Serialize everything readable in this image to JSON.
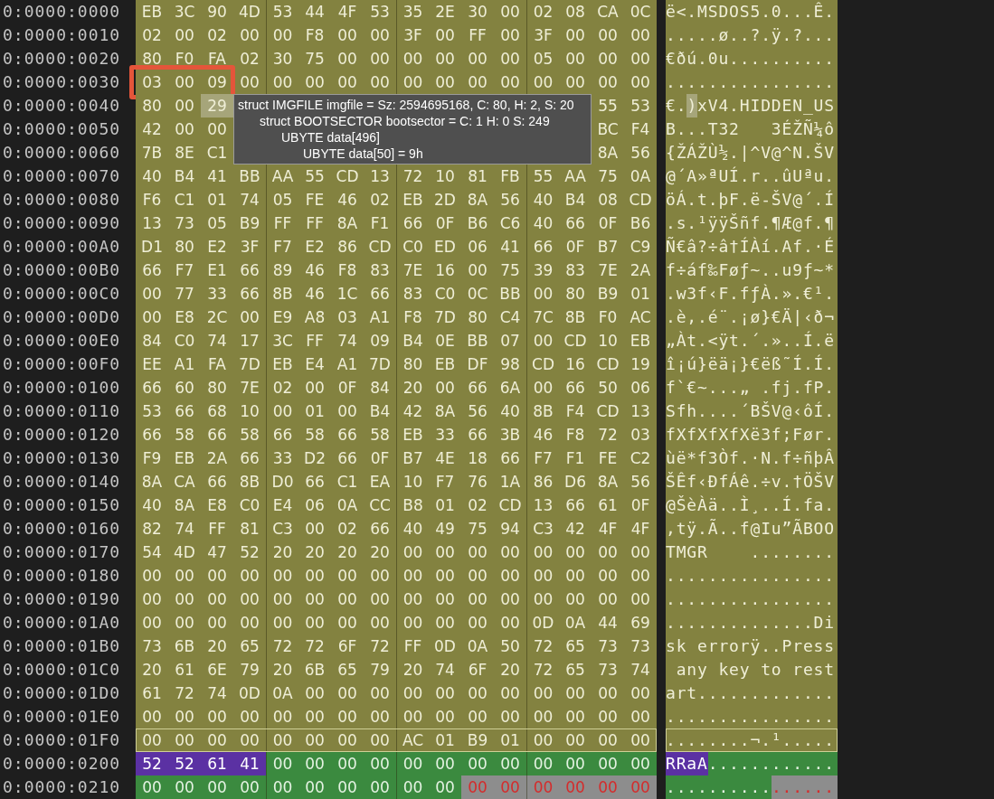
{
  "rows": [
    {
      "offset": "0:0000:0000",
      "framed": false,
      "outlined": false,
      "hex": [
        {
          "kind": "boot",
          "bytes": [
            "EB",
            "3C",
            "90",
            "4D",
            "53",
            "44",
            "4F",
            "53",
            "35",
            "2E",
            "30",
            "00",
            "02",
            "08",
            "CA",
            "0C"
          ]
        }
      ],
      "ascii": [
        {
          "kind": "boot",
          "text": "ë<.MSDOS5.0...Ê."
        }
      ]
    },
    {
      "offset": "0:0000:0010",
      "framed": false,
      "outlined": false,
      "hex": [
        {
          "kind": "boot",
          "bytes": [
            "02",
            "00",
            "02",
            "00",
            "00",
            "F8",
            "00",
            "00",
            "3F",
            "00",
            "FF",
            "00",
            "3F",
            "00",
            "00",
            "00"
          ]
        }
      ],
      "ascii": [
        {
          "kind": "boot",
          "text": ".....ø..?.ÿ.?..."
        }
      ]
    },
    {
      "offset": "0:0000:0020",
      "framed": false,
      "outlined": false,
      "hex": [
        {
          "kind": "boot",
          "bytes": [
            "80",
            "F0",
            "FA",
            "02",
            "30",
            "75",
            "00",
            "00",
            "00",
            "00",
            "00",
            "00",
            "05",
            "00",
            "00",
            "00"
          ]
        }
      ],
      "ascii": [
        {
          "kind": "boot",
          "text": "€ðú.0u.........."
        }
      ]
    },
    {
      "offset": "0:0000:0030",
      "framed": true,
      "outlined": false,
      "hex": [
        {
          "kind": "boot",
          "bytes": [
            "03",
            "00",
            "09",
            "00",
            "00",
            "00",
            "00",
            "00",
            "00",
            "00",
            "00",
            "00",
            "00",
            "00",
            "00",
            "00"
          ]
        }
      ],
      "ascii": [
        {
          "kind": "boot",
          "text": "................"
        }
      ]
    },
    {
      "offset": "0:0000:0040",
      "framed": false,
      "outlined": false,
      "hex": [
        {
          "kind": "boot",
          "bytes": [
            "80",
            "00"
          ]
        },
        {
          "kind": "cursor",
          "bytes": [
            "29"
          ]
        },
        {
          "kind": "covered"
        },
        {
          "kind": "boot",
          "bytes": [
            "55",
            "53"
          ]
        }
      ],
      "ascii": [
        {
          "kind": "boot",
          "text": "€."
        },
        {
          "kind": "cursor",
          "text": ")"
        },
        {
          "kind": "boot",
          "text": "xV4.HIDDEN_US"
        }
      ]
    },
    {
      "offset": "0:0000:0050",
      "framed": false,
      "outlined": false,
      "hex": [
        {
          "kind": "boot",
          "bytes": [
            "42",
            "00",
            "00"
          ]
        },
        {
          "kind": "covered"
        },
        {
          "kind": "boot",
          "bytes": [
            "BC",
            "F4"
          ]
        }
      ],
      "ascii": [
        {
          "kind": "boot",
          "text": "B...T32   3ÉŽÑ¼ô"
        }
      ]
    },
    {
      "offset": "0:0000:0060",
      "framed": false,
      "outlined": false,
      "hex": [
        {
          "kind": "boot",
          "bytes": [
            "7B",
            "8E",
            "C1"
          ]
        },
        {
          "kind": "covered"
        },
        {
          "kind": "boot",
          "bytes": [
            "8A",
            "56"
          ]
        }
      ],
      "ascii": [
        {
          "kind": "boot",
          "text": "{ŽÁŽÙ½.|^V@^N.ŠV"
        }
      ]
    },
    {
      "offset": "0:0000:0070",
      "framed": false,
      "outlined": false,
      "hex": [
        {
          "kind": "boot",
          "bytes": [
            "40",
            "B4",
            "41",
            "BB",
            "AA",
            "55",
            "CD",
            "13",
            "72",
            "10",
            "81",
            "FB",
            "55",
            "AA",
            "75",
            "0A"
          ]
        }
      ],
      "ascii": [
        {
          "kind": "boot",
          "text": "@´A»ªUÍ.r..ûUªu."
        }
      ]
    },
    {
      "offset": "0:0000:0080",
      "framed": false,
      "outlined": false,
      "hex": [
        {
          "kind": "boot",
          "bytes": [
            "F6",
            "C1",
            "01",
            "74",
            "05",
            "FE",
            "46",
            "02",
            "EB",
            "2D",
            "8A",
            "56",
            "40",
            "B4",
            "08",
            "CD"
          ]
        }
      ],
      "ascii": [
        {
          "kind": "boot",
          "text": "öÁ.t.þF.ë-ŠV@´.Í"
        }
      ]
    },
    {
      "offset": "0:0000:0090",
      "framed": false,
      "outlined": false,
      "hex": [
        {
          "kind": "boot",
          "bytes": [
            "13",
            "73",
            "05",
            "B9",
            "FF",
            "FF",
            "8A",
            "F1",
            "66",
            "0F",
            "B6",
            "C6",
            "40",
            "66",
            "0F",
            "B6"
          ]
        }
      ],
      "ascii": [
        {
          "kind": "boot",
          "text": ".s.¹ÿÿŠñf.¶Æ@f.¶"
        }
      ]
    },
    {
      "offset": "0:0000:00A0",
      "framed": false,
      "outlined": false,
      "hex": [
        {
          "kind": "boot",
          "bytes": [
            "D1",
            "80",
            "E2",
            "3F",
            "F7",
            "E2",
            "86",
            "CD",
            "C0",
            "ED",
            "06",
            "41",
            "66",
            "0F",
            "B7",
            "C9"
          ]
        }
      ],
      "ascii": [
        {
          "kind": "boot",
          "text": "Ñ€â?÷â†ÍÀí.Af.·É"
        }
      ]
    },
    {
      "offset": "0:0000:00B0",
      "framed": false,
      "outlined": false,
      "hex": [
        {
          "kind": "boot",
          "bytes": [
            "66",
            "F7",
            "E1",
            "66",
            "89",
            "46",
            "F8",
            "83",
            "7E",
            "16",
            "00",
            "75",
            "39",
            "83",
            "7E",
            "2A"
          ]
        }
      ],
      "ascii": [
        {
          "kind": "boot",
          "text": "f÷áf‰Føƒ~..u9ƒ~*"
        }
      ]
    },
    {
      "offset": "0:0000:00C0",
      "framed": false,
      "outlined": false,
      "hex": [
        {
          "kind": "boot",
          "bytes": [
            "00",
            "77",
            "33",
            "66",
            "8B",
            "46",
            "1C",
            "66",
            "83",
            "C0",
            "0C",
            "BB",
            "00",
            "80",
            "B9",
            "01"
          ]
        }
      ],
      "ascii": [
        {
          "kind": "boot",
          "text": ".w3f‹F.fƒÀ.».€¹."
        }
      ]
    },
    {
      "offset": "0:0000:00D0",
      "framed": false,
      "outlined": false,
      "hex": [
        {
          "kind": "boot",
          "bytes": [
            "00",
            "E8",
            "2C",
            "00",
            "E9",
            "A8",
            "03",
            "A1",
            "F8",
            "7D",
            "80",
            "C4",
            "7C",
            "8B",
            "F0",
            "AC"
          ]
        }
      ],
      "ascii": [
        {
          "kind": "boot",
          "text": ".è,.é¨.¡ø}€Ä|‹ð¬"
        }
      ]
    },
    {
      "offset": "0:0000:00E0",
      "framed": false,
      "outlined": false,
      "hex": [
        {
          "kind": "boot",
          "bytes": [
            "84",
            "C0",
            "74",
            "17",
            "3C",
            "FF",
            "74",
            "09",
            "B4",
            "0E",
            "BB",
            "07",
            "00",
            "CD",
            "10",
            "EB"
          ]
        }
      ],
      "ascii": [
        {
          "kind": "boot",
          "text": "„Àt.<ÿt.´.»..Í.ë"
        }
      ]
    },
    {
      "offset": "0:0000:00F0",
      "framed": false,
      "outlined": false,
      "hex": [
        {
          "kind": "boot",
          "bytes": [
            "EE",
            "A1",
            "FA",
            "7D",
            "EB",
            "E4",
            "A1",
            "7D",
            "80",
            "EB",
            "DF",
            "98",
            "CD",
            "16",
            "CD",
            "19"
          ]
        }
      ],
      "ascii": [
        {
          "kind": "boot",
          "text": "î¡ú}ëä¡}€ëß˜Í.Í."
        }
      ]
    },
    {
      "offset": "0:0000:0100",
      "framed": false,
      "outlined": false,
      "hex": [
        {
          "kind": "boot",
          "bytes": [
            "66",
            "60",
            "80",
            "7E",
            "02",
            "00",
            "0F",
            "84",
            "20",
            "00",
            "66",
            "6A",
            "00",
            "66",
            "50",
            "06"
          ]
        }
      ],
      "ascii": [
        {
          "kind": "boot",
          "text": "f`€~...„ .fj.fP."
        }
      ]
    },
    {
      "offset": "0:0000:0110",
      "framed": false,
      "outlined": false,
      "hex": [
        {
          "kind": "boot",
          "bytes": [
            "53",
            "66",
            "68",
            "10",
            "00",
            "01",
            "00",
            "B4",
            "42",
            "8A",
            "56",
            "40",
            "8B",
            "F4",
            "CD",
            "13"
          ]
        }
      ],
      "ascii": [
        {
          "kind": "boot",
          "text": "Sfh....´BŠV@‹ôÍ."
        }
      ]
    },
    {
      "offset": "0:0000:0120",
      "framed": false,
      "outlined": false,
      "hex": [
        {
          "kind": "boot",
          "bytes": [
            "66",
            "58",
            "66",
            "58",
            "66",
            "58",
            "66",
            "58",
            "EB",
            "33",
            "66",
            "3B",
            "46",
            "F8",
            "72",
            "03"
          ]
        }
      ],
      "ascii": [
        {
          "kind": "boot",
          "text": "fXfXfXfXë3f;Før."
        }
      ]
    },
    {
      "offset": "0:0000:0130",
      "framed": false,
      "outlined": false,
      "hex": [
        {
          "kind": "boot",
          "bytes": [
            "F9",
            "EB",
            "2A",
            "66",
            "33",
            "D2",
            "66",
            "0F",
            "B7",
            "4E",
            "18",
            "66",
            "F7",
            "F1",
            "FE",
            "C2"
          ]
        }
      ],
      "ascii": [
        {
          "kind": "boot",
          "text": "ùë*f3Òf.·N.f÷ñþÂ"
        }
      ]
    },
    {
      "offset": "0:0000:0140",
      "framed": false,
      "outlined": false,
      "hex": [
        {
          "kind": "boot",
          "bytes": [
            "8A",
            "CA",
            "66",
            "8B",
            "D0",
            "66",
            "C1",
            "EA",
            "10",
            "F7",
            "76",
            "1A",
            "86",
            "D6",
            "8A",
            "56"
          ]
        }
      ],
      "ascii": [
        {
          "kind": "boot",
          "text": "ŠÊf‹ÐfÁê.÷v.†ÖŠV"
        }
      ]
    },
    {
      "offset": "0:0000:0150",
      "framed": false,
      "outlined": false,
      "hex": [
        {
          "kind": "boot",
          "bytes": [
            "40",
            "8A",
            "E8",
            "C0",
            "E4",
            "06",
            "0A",
            "CC",
            "B8",
            "01",
            "02",
            "CD",
            "13",
            "66",
            "61",
            "0F"
          ]
        }
      ],
      "ascii": [
        {
          "kind": "boot",
          "text": "@ŠèÀä..Ì¸..Í.fa."
        }
      ]
    },
    {
      "offset": "0:0000:0160",
      "framed": false,
      "outlined": false,
      "hex": [
        {
          "kind": "boot",
          "bytes": [
            "82",
            "74",
            "FF",
            "81",
            "C3",
            "00",
            "02",
            "66",
            "40",
            "49",
            "75",
            "94",
            "C3",
            "42",
            "4F",
            "4F"
          ]
        }
      ],
      "ascii": [
        {
          "kind": "boot",
          "text": "‚tÿ.Ã..f@Iu”ÃBOO"
        }
      ]
    },
    {
      "offset": "0:0000:0170",
      "framed": false,
      "outlined": false,
      "hex": [
        {
          "kind": "boot",
          "bytes": [
            "54",
            "4D",
            "47",
            "52",
            "20",
            "20",
            "20",
            "20",
            "00",
            "00",
            "00",
            "00",
            "00",
            "00",
            "00",
            "00"
          ]
        }
      ],
      "ascii": [
        {
          "kind": "boot",
          "text": "TMGR    ........"
        }
      ]
    },
    {
      "offset": "0:0000:0180",
      "framed": false,
      "outlined": false,
      "hex": [
        {
          "kind": "boot",
          "bytes": [
            "00",
            "00",
            "00",
            "00",
            "00",
            "00",
            "00",
            "00",
            "00",
            "00",
            "00",
            "00",
            "00",
            "00",
            "00",
            "00"
          ]
        }
      ],
      "ascii": [
        {
          "kind": "boot",
          "text": "................"
        }
      ]
    },
    {
      "offset": "0:0000:0190",
      "framed": false,
      "outlined": false,
      "hex": [
        {
          "kind": "boot",
          "bytes": [
            "00",
            "00",
            "00",
            "00",
            "00",
            "00",
            "00",
            "00",
            "00",
            "00",
            "00",
            "00",
            "00",
            "00",
            "00",
            "00"
          ]
        }
      ],
      "ascii": [
        {
          "kind": "boot",
          "text": "................"
        }
      ]
    },
    {
      "offset": "0:0000:01A0",
      "framed": false,
      "outlined": false,
      "hex": [
        {
          "kind": "boot",
          "bytes": [
            "00",
            "00",
            "00",
            "00",
            "00",
            "00",
            "00",
            "00",
            "00",
            "00",
            "00",
            "00",
            "0D",
            "0A",
            "44",
            "69"
          ]
        }
      ],
      "ascii": [
        {
          "kind": "boot",
          "text": "..............Di"
        }
      ]
    },
    {
      "offset": "0:0000:01B0",
      "framed": false,
      "outlined": false,
      "hex": [
        {
          "kind": "boot",
          "bytes": [
            "73",
            "6B",
            "20",
            "65",
            "72",
            "72",
            "6F",
            "72",
            "FF",
            "0D",
            "0A",
            "50",
            "72",
            "65",
            "73",
            "73"
          ]
        }
      ],
      "ascii": [
        {
          "kind": "boot",
          "text": "sk errorÿ..Press"
        }
      ]
    },
    {
      "offset": "0:0000:01C0",
      "framed": false,
      "outlined": false,
      "hex": [
        {
          "kind": "boot",
          "bytes": [
            "20",
            "61",
            "6E",
            "79",
            "20",
            "6B",
            "65",
            "79",
            "20",
            "74",
            "6F",
            "20",
            "72",
            "65",
            "73",
            "74"
          ]
        }
      ],
      "ascii": [
        {
          "kind": "boot",
          "text": " any key to rest"
        }
      ]
    },
    {
      "offset": "0:0000:01D0",
      "framed": false,
      "outlined": false,
      "hex": [
        {
          "kind": "boot",
          "bytes": [
            "61",
            "72",
            "74",
            "0D",
            "0A",
            "00",
            "00",
            "00",
            "00",
            "00",
            "00",
            "00",
            "00",
            "00",
            "00",
            "00"
          ]
        }
      ],
      "ascii": [
        {
          "kind": "boot",
          "text": "art............."
        }
      ]
    },
    {
      "offset": "0:0000:01E0",
      "framed": false,
      "outlined": false,
      "hex": [
        {
          "kind": "boot",
          "bytes": [
            "00",
            "00",
            "00",
            "00",
            "00",
            "00",
            "00",
            "00",
            "00",
            "00",
            "00",
            "00",
            "00",
            "00",
            "00",
            "00"
          ]
        }
      ],
      "ascii": [
        {
          "kind": "boot",
          "text": "................"
        }
      ]
    },
    {
      "offset": "0:0000:01F0",
      "framed": false,
      "outlined": true,
      "hex": [
        {
          "kind": "boot",
          "bytes": [
            "00",
            "00",
            "00",
            "00",
            "00",
            "00",
            "00",
            "00",
            "AC",
            "01",
            "B9",
            "01",
            "00",
            "00",
            "00",
            "00"
          ]
        }
      ],
      "ascii": [
        {
          "kind": "boot",
          "text": "........¬.¹....."
        }
      ]
    },
    {
      "offset": "0:0000:0200",
      "framed": false,
      "outlined": false,
      "hex": [
        {
          "kind": "marked",
          "bytes": [
            "52",
            "52",
            "61",
            "41"
          ]
        },
        {
          "kind": "data",
          "bytes": [
            "00",
            "00",
            "00",
            "00",
            "00",
            "00",
            "00",
            "00",
            "00",
            "00",
            "00",
            "00"
          ]
        }
      ],
      "ascii": [
        {
          "kind": "marked",
          "text": "RRaA"
        },
        {
          "kind": "data",
          "text": "............"
        }
      ]
    },
    {
      "offset": "0:0000:0210",
      "framed": false,
      "outlined": false,
      "hex": [
        {
          "kind": "data",
          "bytes": [
            "00",
            "00",
            "00",
            "00",
            "00",
            "00",
            "00",
            "00",
            "00",
            "00"
          ]
        },
        {
          "kind": "unmapped",
          "bytes": [
            "00",
            "00",
            "00",
            "00",
            "00",
            "00"
          ]
        }
      ],
      "ascii": [
        {
          "kind": "data",
          "text": ".........."
        },
        {
          "kind": "unmapped",
          "text": "......"
        }
      ]
    }
  ],
  "tooltip": {
    "lines": [
      {
        "text": "struct IMGFILE imgfile = Sz: 2594695168, C: 80, H: 2, S: 20",
        "children": [
          {
            "text": "struct BOOTSECTOR bootsector = C: 1 H: 0 S: 249",
            "children": [
              {
                "text": "UBYTE data[496]",
                "children": [
                  {
                    "text": "UBYTE data[50] = 9h"
                  }
                ]
              }
            ]
          }
        ]
      }
    ]
  }
}
